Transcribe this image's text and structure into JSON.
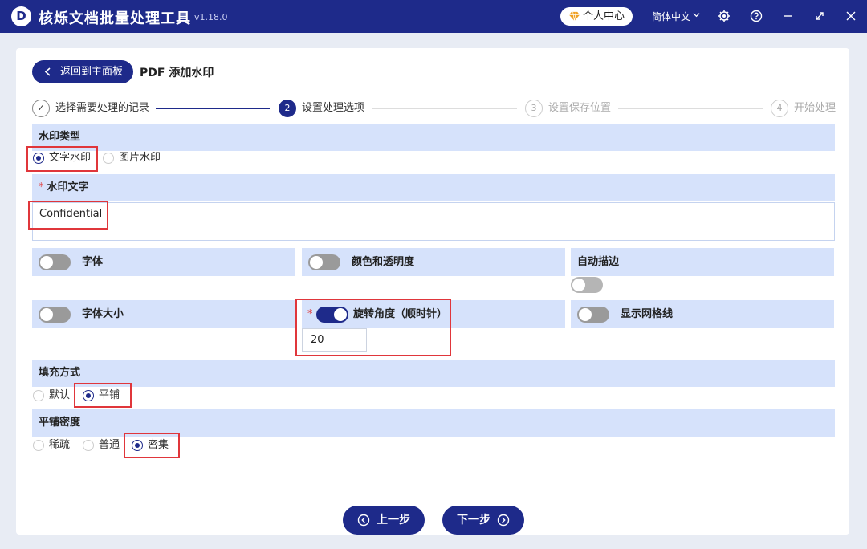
{
  "app": {
    "logo": "D",
    "title": "核烁文档批量处理工具",
    "version": "v1.18.0",
    "user_center": "个人中心",
    "language": "简体中文"
  },
  "icons": {
    "diamond": "diamond-icon",
    "chevron": "chevron-down-icon",
    "settings": "gear-icon",
    "help": "help-icon",
    "minimize": "minimize-icon",
    "maximize": "maximize-icon",
    "close": "close-icon"
  },
  "colors": {
    "primary": "#1e2a8a",
    "section_bg": "#d6e2fb",
    "highlight": "#e0363b"
  },
  "header": {
    "back_label": "返回到主面板",
    "page_title": "PDF 添加水印"
  },
  "steps": [
    {
      "num": "✓",
      "label": "选择需要处理的记录",
      "state": "done"
    },
    {
      "num": "2",
      "label": "设置处理选项",
      "state": "active"
    },
    {
      "num": "3",
      "label": "设置保存位置",
      "state": "pending"
    },
    {
      "num": "4",
      "label": "开始处理",
      "state": "pending"
    }
  ],
  "watermark_type": {
    "title": "水印类型",
    "options": [
      {
        "label": "文字水印",
        "selected": true
      },
      {
        "label": "图片水印",
        "selected": false
      }
    ]
  },
  "watermark_text": {
    "required_mark": "*",
    "title": "水印文字",
    "value": "Confidential"
  },
  "options": {
    "font": {
      "label": "字体",
      "on": false
    },
    "color_opacity": {
      "label": "颜色和透明度",
      "on": false
    },
    "auto_stroke": {
      "label": "自动描边",
      "on": false
    },
    "font_size": {
      "label": "字体大小",
      "on": false
    },
    "rotation": {
      "required_mark": "*",
      "label": "旋转角度（顺时针）",
      "on": true,
      "value": "20"
    },
    "grid_lines": {
      "label": "显示网格线",
      "on": false
    }
  },
  "fill_mode": {
    "title": "填充方式",
    "options": [
      {
        "label": "默认",
        "selected": false
      },
      {
        "label": "平铺",
        "selected": true
      }
    ]
  },
  "tile_density": {
    "title": "平铺密度",
    "options": [
      {
        "label": "稀疏",
        "selected": false
      },
      {
        "label": "普通",
        "selected": false
      },
      {
        "label": "密集",
        "selected": true
      }
    ]
  },
  "footer": {
    "prev_label": "上一步",
    "next_label": "下一步"
  }
}
